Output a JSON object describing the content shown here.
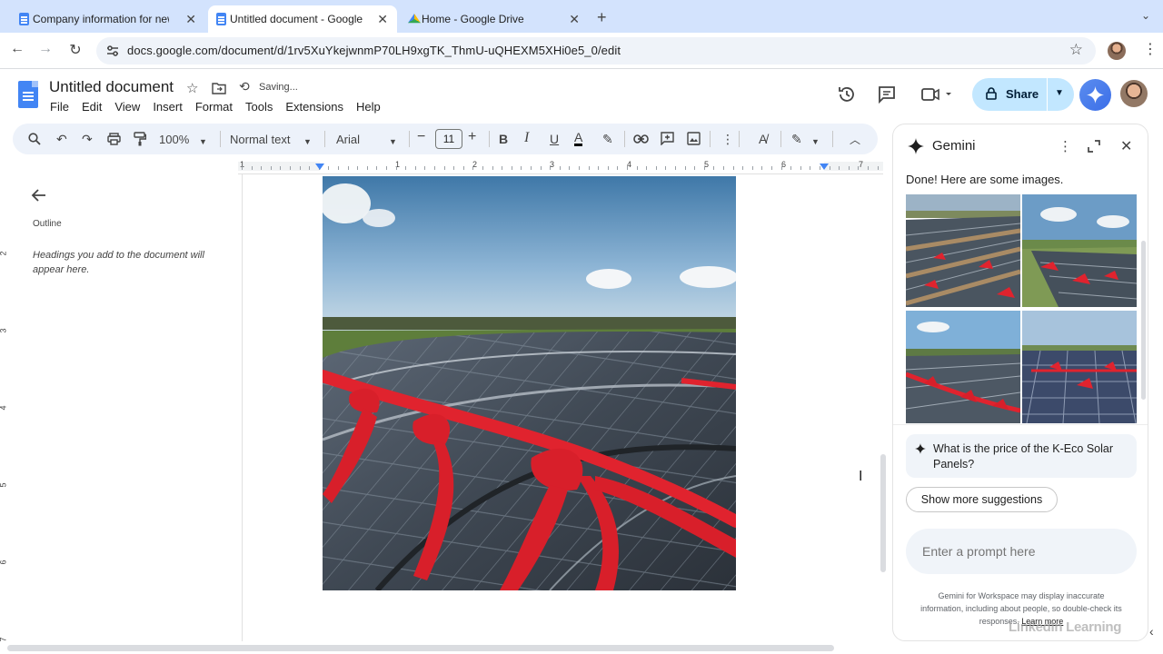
{
  "browser": {
    "tabs": [
      {
        "title": "Company information for new",
        "icon": "docs-icon",
        "active": false
      },
      {
        "title": "Untitled document - Google D",
        "icon": "docs-icon",
        "active": true
      },
      {
        "title": "Home - Google Drive",
        "icon": "drive-icon",
        "active": false
      }
    ],
    "url": "docs.google.com/document/d/1rv5XuYkejwnmP70LH9xgTK_ThmU-uQHEXM5XHi0e5_0/edit"
  },
  "docs": {
    "title": "Untitled document",
    "status": "Saving...",
    "menu": [
      "File",
      "Edit",
      "View",
      "Insert",
      "Format",
      "Tools",
      "Extensions",
      "Help"
    ],
    "share_label": "Share",
    "toolbar": {
      "zoom": "100%",
      "style": "Normal text",
      "font": "Arial",
      "font_size": "11"
    },
    "ruler_numbers": [
      "1",
      "1",
      "2",
      "3",
      "4",
      "5",
      "6",
      "7"
    ],
    "vruler_numbers": [
      "2",
      "3",
      "4",
      "5",
      "6",
      "7"
    ],
    "outline": {
      "title": "Outline",
      "hint": "Headings you add to the document will appear here."
    }
  },
  "gemini": {
    "title": "Gemini",
    "message": "Done! Here are some images.",
    "suggestion": "What is the price of the K-Eco Solar Panels?",
    "show_more": "Show more suggestions",
    "prompt_placeholder": "Enter a prompt here",
    "disclaimer": "Gemini for Workspace may display inaccurate information, including about people, so double-check its responses.",
    "learn_more": "Learn more"
  },
  "watermark": "LinkedIn Learning",
  "colors": {
    "accent": "#1a73e8",
    "share_bg": "#c2e7ff",
    "tabbar_bg": "#d3e3fd",
    "toolbar_bg": "#edf2fa",
    "ribbon_red": "#e0232e"
  }
}
